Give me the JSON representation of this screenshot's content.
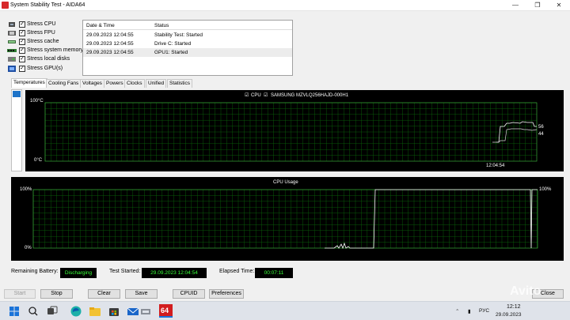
{
  "window": {
    "title": "System Stability Test - AIDA64",
    "minimize_glyph": "—",
    "maximize_glyph": "❐",
    "close_glyph": "✕"
  },
  "stress_options": [
    {
      "label": "Stress CPU",
      "checked": true,
      "icon": "cpu-icon"
    },
    {
      "label": "Stress FPU",
      "checked": true,
      "icon": "fpu-icon"
    },
    {
      "label": "Stress cache",
      "checked": true,
      "icon": "cache-icon"
    },
    {
      "label": "Stress system memory",
      "checked": true,
      "icon": "memory-icon"
    },
    {
      "label": "Stress local disks",
      "checked": true,
      "icon": "disk-icon"
    },
    {
      "label": "Stress GPU(s)",
      "checked": true,
      "icon": "gpu-icon"
    }
  ],
  "log": {
    "columns": [
      "Date & Time",
      "Status"
    ],
    "rows": [
      [
        "29.09.2023 12:04:55",
        "Stability Test: Started"
      ],
      [
        "29.09.2023 12:04:55",
        "Drive C: Started"
      ],
      [
        "29.09.2023 12:04:55",
        "GPU1: Started"
      ]
    ]
  },
  "tabs": [
    "Temperatures",
    "Cooling Fans",
    "Voltages",
    "Powers",
    "Clocks",
    "Unified",
    "Statistics"
  ],
  "active_tab": "Temperatures",
  "temperature_graph": {
    "legend": [
      {
        "label": "CPU",
        "checked": true
      },
      {
        "label": "SAMSUNG MZVLQ256HAJD-000H1",
        "checked": true
      }
    ],
    "y_top_label": "100°C",
    "y_bottom_label": "0°C",
    "x_time_label": "12:04:54",
    "value_cpu_label": "56",
    "value_disk_label": "44",
    "colors": {
      "grid": "#0a6e0a",
      "cpu": "#ffffff",
      "disk": "#d8d8d8",
      "axis": "#3aa83a"
    }
  },
  "cpu_usage_graph": {
    "title": "CPU Usage",
    "y_top_label": "100%",
    "y_bottom_label": "0%",
    "value_label": "100%",
    "colors": {
      "grid": "#0a6e0a",
      "line": "#ffffff"
    }
  },
  "status": {
    "battery_label": "Remaining Battery:",
    "battery_value": "Discharging",
    "started_label": "Test Started:",
    "started_value": "29.09.2023 12:04:54",
    "elapsed_label": "Elapsed Time:",
    "elapsed_value": "00:07:11"
  },
  "buttons": {
    "start": "Start",
    "stop": "Stop",
    "clear": "Clear",
    "save": "Save",
    "cpuid": "CPUID",
    "preferences": "Preferences",
    "close": "Close"
  },
  "taskbar": {
    "aida_label": "64",
    "lang": "РУС",
    "time": "12:12",
    "date": "29.09.2023",
    "watermark": "Avito"
  }
}
